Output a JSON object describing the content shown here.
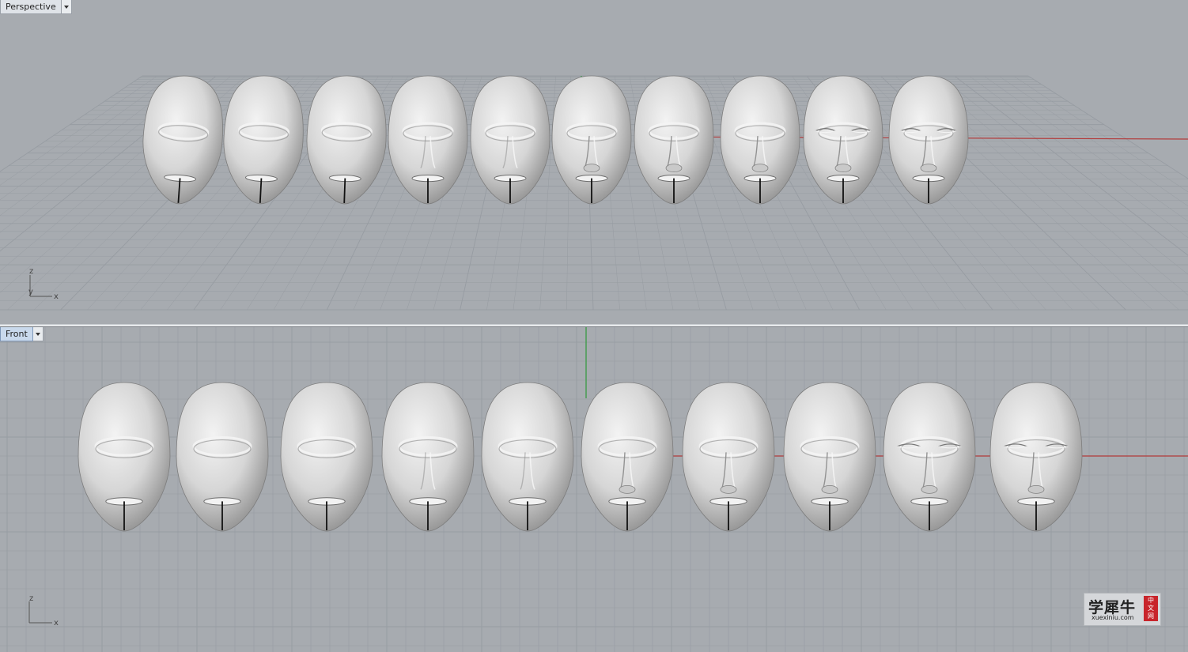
{
  "viewports": {
    "perspective": {
      "label": "Perspective",
      "axes": {
        "z": "z",
        "y": "y",
        "x": "x"
      }
    },
    "front": {
      "label": "Front",
      "axes": {
        "z": "z",
        "x": "x"
      }
    }
  },
  "models": {
    "face_count": 10,
    "description_stages": [
      "blank",
      "brow",
      "brow",
      "nose-ridge",
      "nose-ridge",
      "nose",
      "nose",
      "nose-detail",
      "eyes",
      "eyes-detail"
    ]
  },
  "colors": {
    "background": "#a7abb0",
    "grid": "#979ca2",
    "x_axis": "#b33a3a",
    "y_axis": "#2f9a3a",
    "face": "#d9d9d9"
  },
  "watermark": {
    "text": "学犀牛",
    "url": "xuexiniu.com",
    "seal": [
      "中",
      "文",
      "网"
    ]
  }
}
